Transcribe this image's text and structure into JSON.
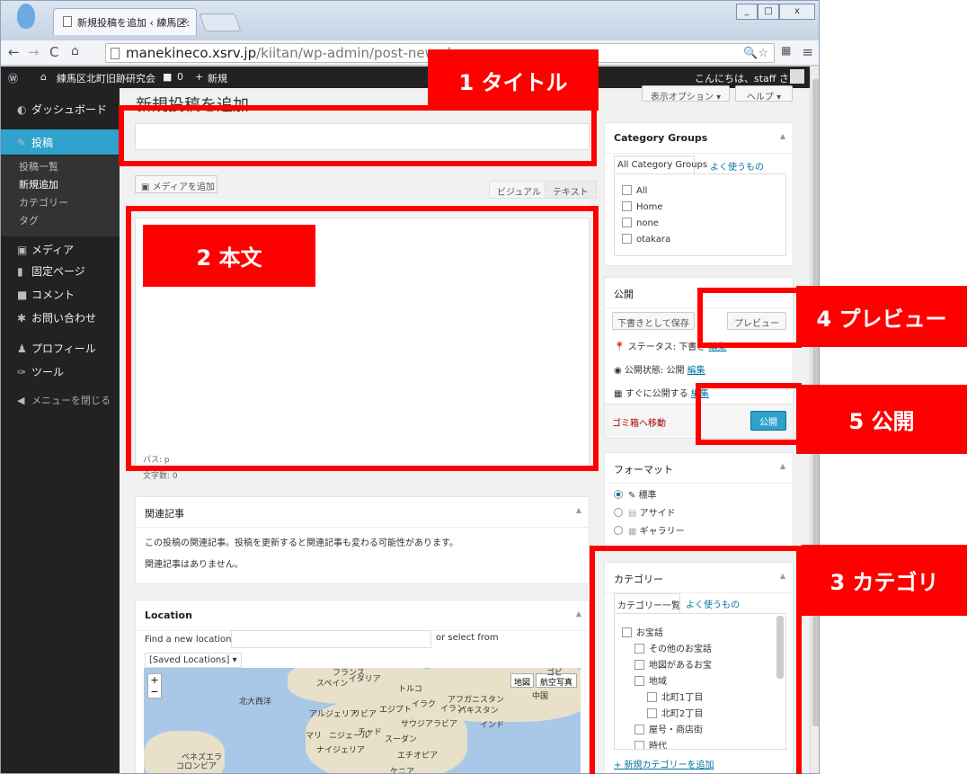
{
  "browser": {
    "tab_title": "新規投稿を追加 ‹ 練馬区:",
    "tab_close": "×",
    "url_host": "manekineco.xsrv.jp",
    "url_path": "/kiitan/wp-admin/post-new.php",
    "window_minimize": "_",
    "window_maximize": "□",
    "window_close": "x"
  },
  "adminbar": {
    "site_name": "練馬区北町旧跡研究会",
    "comments_count": "0",
    "new_label": "新規",
    "greeting": "こんにちは、staff さん！"
  },
  "sidebar": {
    "items": [
      {
        "label": "ダッシュボード"
      },
      {
        "label": "投稿"
      },
      {
        "label": "メディア"
      },
      {
        "label": "固定ページ"
      },
      {
        "label": "コメント"
      },
      {
        "label": "お問い合わせ"
      },
      {
        "label": "プロフィール"
      },
      {
        "label": "ツール"
      },
      {
        "label": "メニューを閉じる"
      }
    ],
    "submenu": [
      "投稿一覧",
      "新規追加",
      "カテゴリー",
      "タグ"
    ]
  },
  "screen_options": {
    "display_options": "表示オプション ▾",
    "help": "ヘルプ ▾"
  },
  "main": {
    "page_title": "新規投稿を追加",
    "title_value": "",
    "add_media": "メディアを追加",
    "tab_visual": "ビジュアル",
    "tab_text": "テキスト",
    "path": "パス: p",
    "word_count": "文字数: 0"
  },
  "related": {
    "title": "関連記事",
    "desc": "この投稿の関連記事。投稿を更新すると関連記事も変わる可能性があります。",
    "none": "関連記事はありません。"
  },
  "location": {
    "title": "Location",
    "find_label": "Find a new location:",
    "or_select": "or select from",
    "saved_locations": "[Saved Locations]",
    "map_btn_map": "地図",
    "map_btn_satellite": "航空写真",
    "zoom_in": "+",
    "zoom_out": "−",
    "labels": [
      "フランス",
      "スペイン",
      "イタリア",
      "トルコ",
      "北大西洋",
      "イラク",
      "アフガニスタン",
      "イラン",
      "パキスタン",
      "アルジェリア",
      "リビア",
      "エジプト",
      "サウジアラビア",
      "インド",
      "マリ",
      "ニジェール",
      "チャド",
      "スーダン",
      "ナイジェリア",
      "エチオピア",
      "ベネズエラ",
      "コロンビア",
      "ケニア",
      "中国",
      "ゴビ"
    ]
  },
  "category_groups": {
    "title": "Category Groups",
    "tab_all": "All Category Groups",
    "tab_popular": "よく使うもの",
    "items": [
      "All",
      "Home",
      "none",
      "otakara"
    ]
  },
  "publish": {
    "title": "公開",
    "save_draft": "下書きとして保存",
    "preview": "プレビュー",
    "status": "ステータス: 下書き",
    "visibility": "公開状態: 公開",
    "schedule": "すぐに公開する",
    "edit": "編集",
    "trash": "ゴミ箱へ移動",
    "publish_btn": "公開"
  },
  "format": {
    "title": "フォーマット",
    "options": [
      "標準",
      "アサイド",
      "ギャラリー"
    ]
  },
  "categories": {
    "title": "カテゴリー",
    "tab_all": "カテゴリー一覧",
    "tab_popular": "よく使うもの",
    "items": [
      "お宝話",
      "その他のお宝話",
      "地図があるお宝",
      "地域",
      "北町1丁目",
      "北町2丁目",
      "屋号・商店街",
      "時代"
    ],
    "add_new": "+ 新規カテゴリーを追加"
  },
  "callouts": {
    "title": "1 タイトル",
    "body": "2 本文",
    "category": "3 カテゴリ",
    "preview": "4 プレビュー",
    "publish": "5 公開"
  },
  "colors": {
    "callout": "#ff0000",
    "wp_blue": "#2ea2cc",
    "admin_dark": "#222222"
  }
}
